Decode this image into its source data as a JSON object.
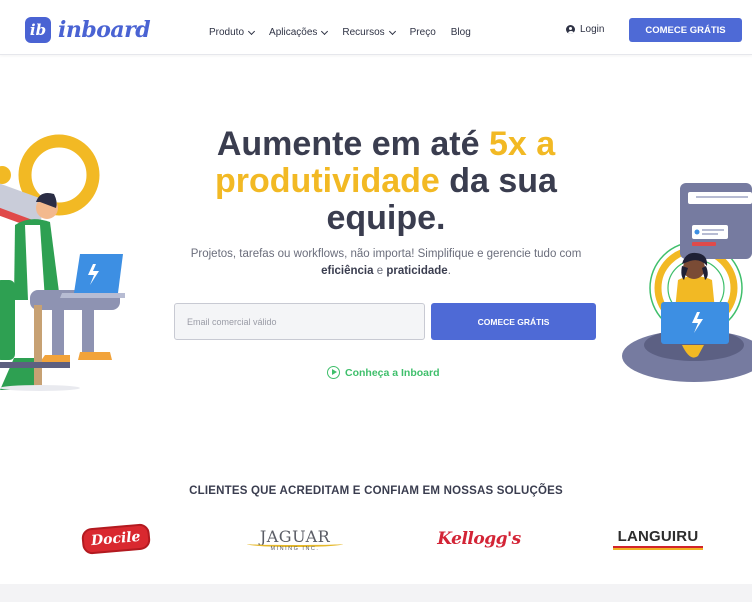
{
  "header": {
    "logo_mark": "ib",
    "logo_text": "inboard",
    "nav": [
      {
        "label": "Produto",
        "dropdown": true
      },
      {
        "label": "Aplicações",
        "dropdown": true
      },
      {
        "label": "Recursos",
        "dropdown": true
      },
      {
        "label": "Preço",
        "dropdown": false
      },
      {
        "label": "Blog",
        "dropdown": false
      }
    ],
    "login_label": "Login",
    "cta_label": "COMECE GRÁTIS"
  },
  "hero": {
    "title_part1": "Aumente em até ",
    "title_highlight1": "5x a",
    "title_highlight2": "produtividade",
    "title_part2": " da sua",
    "title_part3": "equipe.",
    "subtitle_part1": "Projetos, tarefas ou workflows, não importa! Simplifique e gerencie tudo com ",
    "subtitle_bold1": "eficiência",
    "subtitle_and": " e ",
    "subtitle_bold2": "praticidade",
    "subtitle_end": ".",
    "email_placeholder": "Email comercial válido",
    "cta_label": "COMECE GRÁTIS",
    "video_link": "Conheça a Inboard"
  },
  "clients": {
    "title": "CLIENTES QUE ACREDITAM E CONFIAM EM NOSSAS SOLUÇÕES",
    "logos": {
      "docile": "Docile",
      "jaguar_name": "JAGUAR",
      "jaguar_sub": "MINING INC.",
      "kelloggs": "Kellogg's",
      "languiru": "LANGUIRU"
    }
  },
  "colors": {
    "brand_blue": "#4e6ad6",
    "highlight_yellow": "#f2b924",
    "link_green": "#3fbf6b",
    "text_dark": "#3a3d4f"
  },
  "icons": [
    "chevron-down-icon",
    "user-icon",
    "play-icon",
    "lightning-icon"
  ]
}
